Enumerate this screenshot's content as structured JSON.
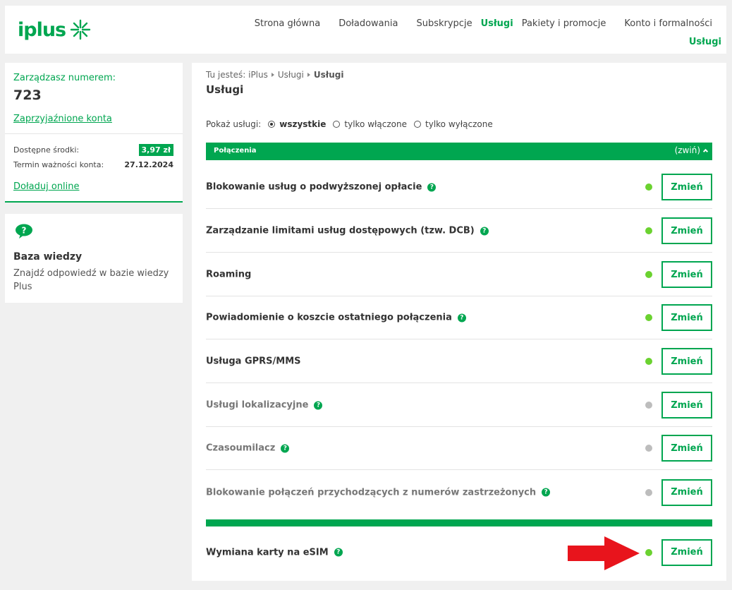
{
  "brand": {
    "name": "iplus",
    "accent_color": "#00a650"
  },
  "nav": {
    "items": [
      "Strona główna",
      "Doładowania",
      "Subskrypcje",
      "Usługi",
      "Pakiety i promocje",
      "Konto i formalności"
    ],
    "active": "Usługi",
    "sub_active": "Usługi"
  },
  "account": {
    "manage_label": "Zarządzasz numerem:",
    "number": "723",
    "linked_accounts": "Zaprzyjaźnione konta",
    "funds_label": "Dostępne środki:",
    "funds_value": "3,97 zł",
    "validity_label": "Termin ważności konta:",
    "validity_value": "27.12.2024",
    "topup_link": "Doładuj online"
  },
  "knowledge": {
    "icon": "question-bubble-icon",
    "title": "Baza wiedzy",
    "description": "Znajdź odpowiedź w bazie wiedzy Plus"
  },
  "breadcrumb": {
    "prefix": "Tu jesteś:",
    "items": [
      "iPlus",
      "Usługi",
      "Usługi"
    ]
  },
  "page_title": "Usługi",
  "filter": {
    "label": "Pokaż usługi:",
    "options": [
      "wszystkie",
      "tylko włączone",
      "tylko wyłączone"
    ],
    "selected": "wszystkie"
  },
  "sections": [
    {
      "title": "Połączenia",
      "toggle_label": "(zwiń)",
      "services": [
        {
          "name": "Blokowanie usług o podwyższonej opłacie",
          "help": true,
          "enabled": true,
          "button": "Zmień"
        },
        {
          "name": "Zarządzanie limitami usług dostępowych (tzw. DCB)",
          "help": true,
          "enabled": true,
          "button": "Zmień"
        },
        {
          "name": "Roaming",
          "help": false,
          "enabled": true,
          "button": "Zmień"
        },
        {
          "name": "Powiadomienie o koszcie ostatniego połączenia",
          "help": true,
          "enabled": true,
          "button": "Zmień"
        },
        {
          "name": "Usługa GPRS/MMS",
          "help": false,
          "enabled": true,
          "button": "Zmień"
        },
        {
          "name": "Usługi lokalizacyjne",
          "help": true,
          "enabled": false,
          "button": "Zmień"
        },
        {
          "name": "Czasoumilacz",
          "help": true,
          "enabled": false,
          "button": "Zmień"
        },
        {
          "name": "Blokowanie połączeń przychodzących z numerów zastrzeżonych",
          "help": true,
          "enabled": false,
          "button": "Zmień"
        }
      ]
    },
    {
      "title": "",
      "toggle_label": "",
      "services": [
        {
          "name": "Wymiana karty na eSIM",
          "help": true,
          "enabled": true,
          "button": "Zmień"
        }
      ]
    }
  ],
  "help_glyph": "?",
  "colors": {
    "status_on": "#6bd230",
    "status_off": "#bdbdbd",
    "arrow": "#e8141c"
  }
}
